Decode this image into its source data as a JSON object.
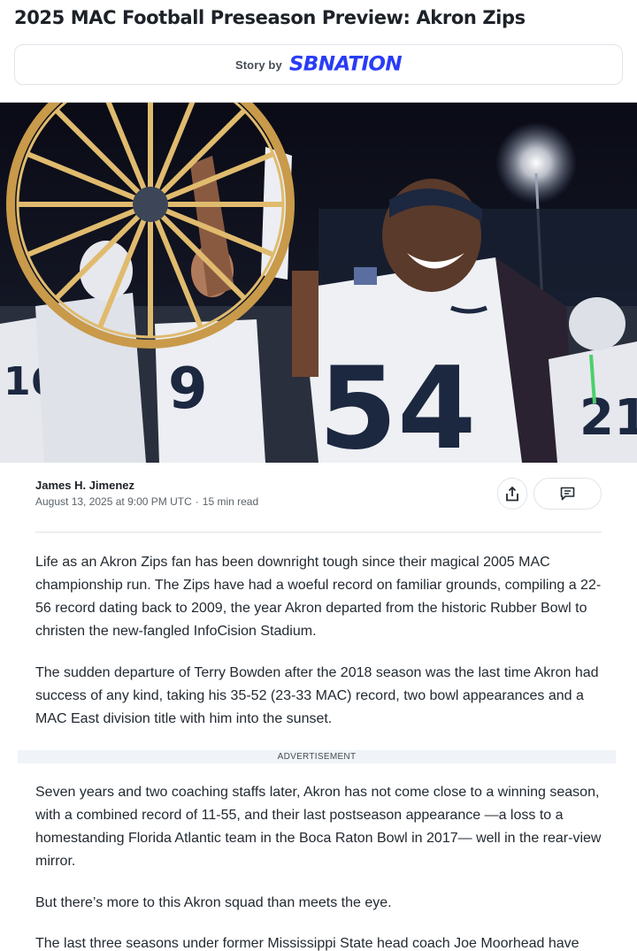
{
  "article": {
    "headline": "2025 MAC Football Preseason Preview: Akron Zips",
    "story_by_label": "Story by",
    "publisher": "SBNATION"
  },
  "hero_image": {
    "description": "Akron Zips players celebrating with the wagon wheel trophy",
    "jersey_numbers": [
      "54",
      "9",
      "16",
      "21"
    ],
    "colors": {
      "sky": "#0d0f1c",
      "jersey": "#eef0f4",
      "navy": "#1c2740",
      "wheel": "#d8b060"
    }
  },
  "byline": {
    "author": "James H. Jimenez",
    "date": "August 13, 2025 at 9:00 PM UTC",
    "separator": "·",
    "read_time": "15 min read"
  },
  "actions": {
    "share_icon": "share-icon",
    "comment_icon": "comment-icon"
  },
  "body": {
    "paragraphs": [
      "Life as an Akron Zips fan has been downright tough since their magical 2005 MAC championship run. The Zips have had a woeful record on familiar grounds, compiling a 22-56 record dating back to 2009, the year Akron departed from the historic Rubber Bowl to christen the new-fangled InfoCision Stadium.",
      "The sudden departure of Terry Bowden after the 2018 season was the last time Akron had success of any kind, taking his 35-52 (23-33 MAC) record, two bowl appearances and a MAC East division title with him into the sunset.",
      "Seven years and two coaching staffs later, Akron has not come close to a winning season, with a combined record of 11-55, and their last postseason appearance —a loss to a homestanding Florida Atlantic team in the Boca Raton Bowl in 2017— well in the rear-view mirror.",
      "But there’s more to this Akron squad than meets the eye.",
      "The last three seasons under former Mississippi State head coach Joe Moorhead have"
    ],
    "advertisement_label": "ADVERTISEMENT"
  },
  "colors": {
    "publisher_blue": "#2a3cf5",
    "text": "#232a31",
    "muted": "#5b636a",
    "border": "#e0e4e9",
    "ad_background": "#f0f4f8"
  }
}
